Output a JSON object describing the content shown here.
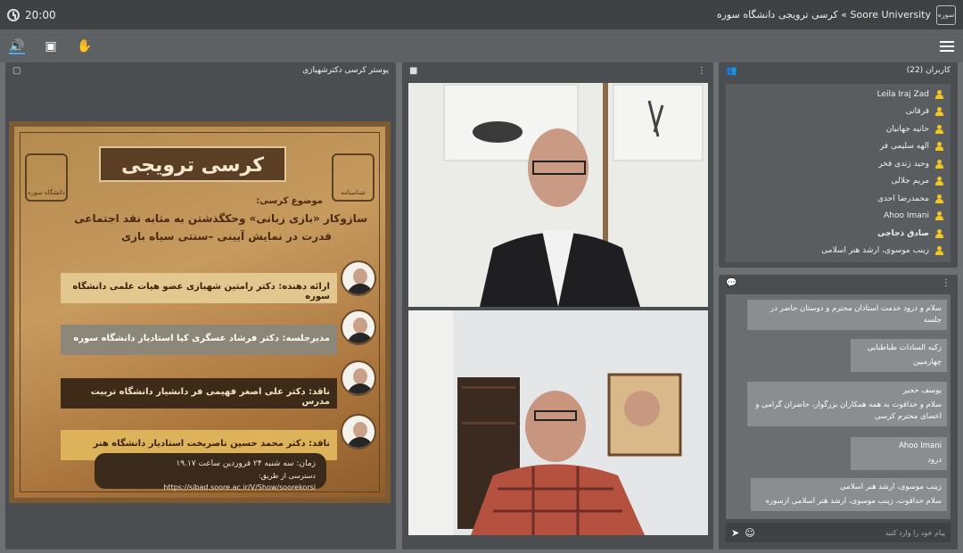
{
  "topbar": {
    "time": "20:00",
    "title": "Soore University » کرسی ترویجی دانشگاه سوره",
    "logo_text": "سوره"
  },
  "poster_panel": {
    "title": "پوستر کرسی دکترشهبازی"
  },
  "poster": {
    "banner": "کرسی ترویجی",
    "logo_right": "شناسنامه",
    "logo_left": "دانشگاه سوره",
    "topic_label": "موضوع کرسی:",
    "topic_line1": "سازوکار «بازی زبانی» وحکگذشتن به مثابه نقد اجتماعی",
    "topic_line2": "قدرت در نمایش آیینی –سنتی سیاه بازی",
    "row1": "ارائه دهنده: دکتر رامتین شهبازی عضو هیات علمی دانشگاه سوره",
    "row2": "مدیرجلسه: دکتر فرشاد عسگری کیا استادیار دانشگاه سوره",
    "row3": "ناقد: دکتر علی اصغر فهیمی فر دانشیار دانشگاه تربیت مدرس",
    "row4": "ناقد: دکتر محمد حسین ناصربخت استادیار دانشگاه هنر",
    "time_line": "زمان: سه شنبه ۲۴ فروردین ساعت ۱۹.۱۷",
    "access_line": "دسترسی از طریق: https://sibad.soore.ac.ir/V/Show/soorekorsi"
  },
  "users_panel": {
    "title": "کاربران (22)",
    "users": [
      {
        "name": "Leila Iraj Zad",
        "bold": false
      },
      {
        "name": "قرقانی",
        "bold": false
      },
      {
        "name": "حانیه جهانیان",
        "bold": false
      },
      {
        "name": "الهه سلیمی فر",
        "bold": false
      },
      {
        "name": "وحید زندی فخر",
        "bold": false
      },
      {
        "name": "مریم جلالی",
        "bold": false
      },
      {
        "name": "محمدرضا احدی",
        "bold": false
      },
      {
        "name": "Ahoo Imani",
        "bold": false
      },
      {
        "name": "صادق ذجاجی",
        "bold": true
      },
      {
        "name": "زینب موسوی، ارشد هنر اسلامی",
        "bold": false
      }
    ]
  },
  "chat_panel": {
    "messages": [
      {
        "who": "",
        "text": "سلام و درود خدمت استادان محترم و دوستان حاضر در جلسه"
      },
      {
        "who": "زکیه السادات طباطبایی",
        "text": "چهارمبین"
      },
      {
        "who": "یوسف خجیر",
        "text": "سلام و خداقوت به همه همکاران بزرگوار، حاضران گرامی و اعضای محترم کرسی"
      },
      {
        "who": "Ahoo Imani",
        "text": "درود"
      },
      {
        "who": "زینب موسوی، ارشد هنر اسلامی",
        "text": "سلام خداقوت، زینب موسوی، ارشد هنر اسلامی ازسوره"
      }
    ],
    "input_placeholder": "پیام خود را وارد کنید"
  },
  "colors": {
    "user_icon": "#f3c623",
    "accent": "#5aa2e8"
  },
  "icons": [
    "clock-icon",
    "speaker-icon",
    "screen-share-icon",
    "raise-hand-icon",
    "menu-icon",
    "users-icon",
    "chat-icon",
    "video-icon",
    "send-icon",
    "emoji-icon"
  ]
}
